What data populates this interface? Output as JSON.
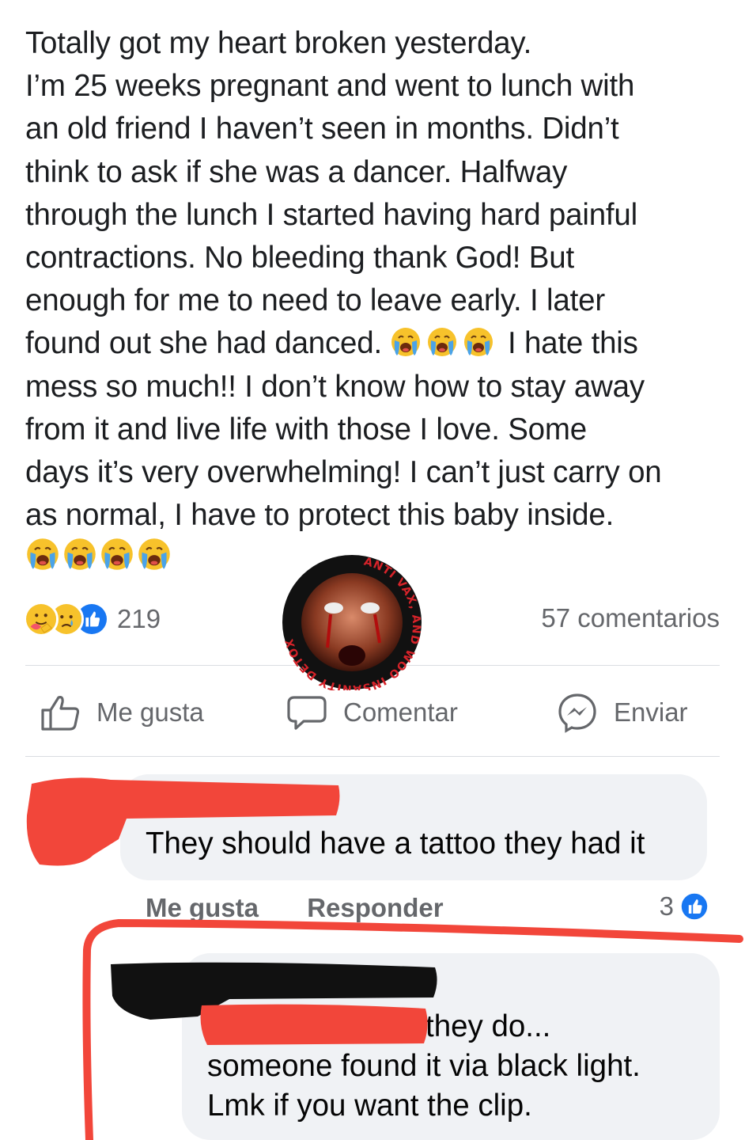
{
  "post": {
    "lines": [
      "Totally got my heart broken yesterday.",
      "I’m 25 weeks pregnant and went to lunch with",
      "an old friend I haven’t seen in months. Didn’t",
      "think to ask if she was a dancer. Halfway",
      "through the lunch I started having hard painful",
      "contractions. No bleeding thank God! But",
      "enough for me to need to leave early. I later"
    ],
    "line8_before": "found out she had danced.",
    "line8_after": "I hate this",
    "lines_rest": [
      "mess so much!! I don’t know how to stay away",
      "from it and live life with those I love. Some",
      "days it’s very overwhelming! I can’t just carry on",
      "as normal, I have to protect this baby inside."
    ],
    "emoji": "crying-face"
  },
  "reactions": {
    "icons": [
      "care-reaction",
      "sad-reaction",
      "like-reaction"
    ],
    "count": "219",
    "comments": "57 comentarios"
  },
  "actions": {
    "like": "Me gusta",
    "comment": "Comentar",
    "send": "Enviar"
  },
  "watermark": {
    "text": "ANTI VAX, AND WOO INSANITY DETOX"
  },
  "comment1": {
    "text": "They should have a tattoo they had it",
    "like_action": "Me gusta",
    "reply_action": "Responder",
    "like_count": "3"
  },
  "comment2": {
    "lines": [
      "they do...",
      "someone found it via black light.",
      "Lmk if you want the clip."
    ]
  },
  "colors": {
    "text": "#1c1e21",
    "secondary": "#65676b",
    "bubble": "#f0f2f5",
    "like_blue": "#1877f2",
    "redact_red": "#f2463a",
    "redact_black": "#111111"
  }
}
